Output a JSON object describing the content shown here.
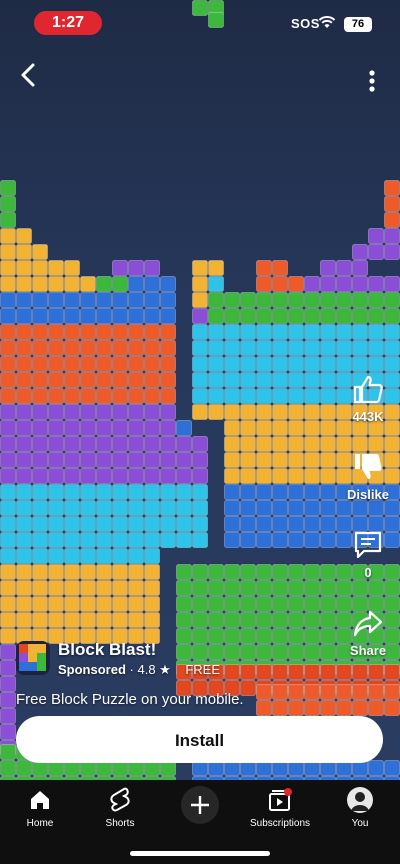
{
  "status_bar": {
    "time": "1:27",
    "sos": "SOS",
    "battery": "76"
  },
  "actions": {
    "like_count": "443K",
    "dislike_label": "Dislike",
    "comment_count": "0",
    "share_label": "Share"
  },
  "ad": {
    "title": "Block Blast!",
    "sponsored": "Sponsored",
    "rating": "4.8 ★",
    "price": "FREE",
    "description": "Free Block Puzzle on your mobile.",
    "cta": "Install"
  },
  "nav": {
    "items": [
      {
        "label": "Home",
        "icon": "home-icon"
      },
      {
        "label": "Shorts",
        "icon": "shorts-icon"
      },
      {
        "label": "Create",
        "icon": "plus-icon"
      },
      {
        "label": "Subscriptions",
        "icon": "subscriptions-icon"
      },
      {
        "label": "You",
        "icon": "avatar"
      }
    ]
  },
  "colors": {
    "status_pill": "#e0262e",
    "nav_bg": "#0f0f0f",
    "block_green": "#3db83d",
    "block_yellow": "#f2b233",
    "block_purple": "#8a4fd6",
    "block_blue": "#2f6fd8",
    "block_cyan": "#2ec3e8",
    "block_orange": "#ef5a2a",
    "block_red": "#e2471f"
  }
}
